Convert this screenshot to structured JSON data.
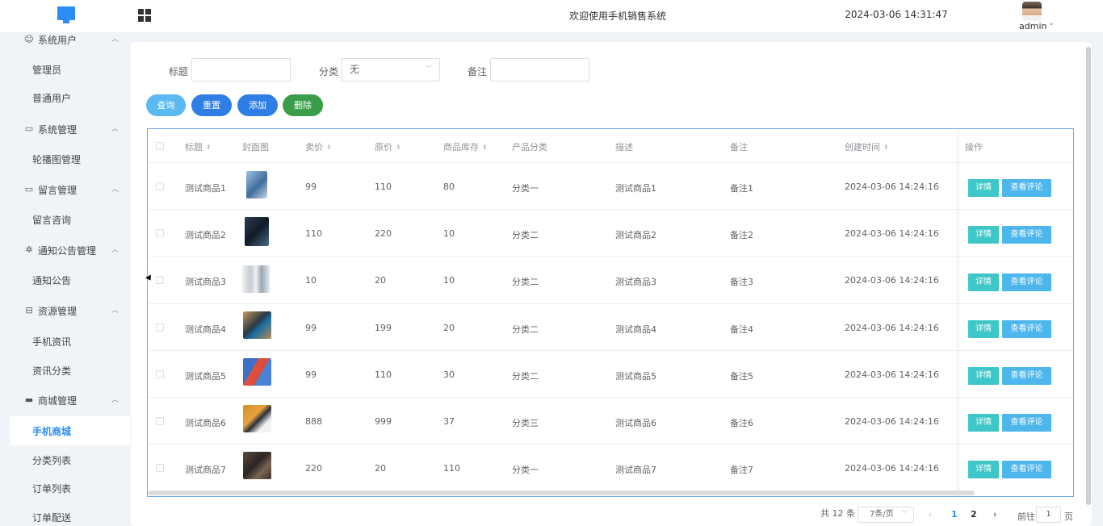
{
  "header": {
    "title": "欢迎使用手机销售系统",
    "datetime": "2024-03-06 14:31:47",
    "username": "admin",
    "user_caret": "˅"
  },
  "sidebar": {
    "groups": [
      {
        "label": "系统用户",
        "icon": "user-icon",
        "items": [
          "管理员",
          "普通用户"
        ]
      },
      {
        "label": "系统管理",
        "icon": "folder-icon",
        "items": [
          "轮播图管理"
        ]
      },
      {
        "label": "留言管理",
        "icon": "folder-icon",
        "items": [
          "留言咨询"
        ]
      },
      {
        "label": "通知公告管理",
        "icon": "loading-icon",
        "items": [
          "通知公告"
        ]
      },
      {
        "label": "资源管理",
        "icon": "database-icon",
        "items": [
          "手机资讯",
          "资讯分类"
        ]
      },
      {
        "label": "商城管理",
        "icon": "monitor-icon",
        "items": [
          "手机商城",
          "分类列表",
          "订单列表",
          "订单配送"
        ]
      }
    ],
    "active_item": "手机商城"
  },
  "filters": {
    "title_label": "标题",
    "title_value": "",
    "category_label": "分类",
    "category_value": "无",
    "remark_label": "备注",
    "remark_value": ""
  },
  "actions": {
    "query": "查询",
    "reset": "重置",
    "add": "添加",
    "delete": "删除"
  },
  "colors": {
    "query": "#5bb9ef",
    "reset": "#2f7ee6",
    "add": "#2f7ee6",
    "delete": "#3a9d4a",
    "primary": "#2d8cf0"
  },
  "table": {
    "columns": [
      "标题",
      "封面图",
      "卖价",
      "原价",
      "商品库存",
      "产品分类",
      "描述",
      "备注",
      "创建时间",
      "操作"
    ],
    "rows": [
      {
        "title": "测试商品1",
        "price": "99",
        "original": "110",
        "stock": "80",
        "category": "分类一",
        "desc": "测试商品1",
        "remark": "备注1",
        "created": "2024-03-06 14:24:16"
      },
      {
        "title": "测试商品2",
        "price": "110",
        "original": "220",
        "stock": "10",
        "category": "分类二",
        "desc": "测试商品2",
        "remark": "备注2",
        "created": "2024-03-06 14:24:16"
      },
      {
        "title": "测试商品3",
        "price": "10",
        "original": "20",
        "stock": "10",
        "category": "分类二",
        "desc": "测试商品3",
        "remark": "备注3",
        "created": "2024-03-06 14:24:16"
      },
      {
        "title": "测试商品4",
        "price": "99",
        "original": "199",
        "stock": "20",
        "category": "分类二",
        "desc": "测试商品4",
        "remark": "备注4",
        "created": "2024-03-06 14:24:16"
      },
      {
        "title": "测试商品5",
        "price": "99",
        "original": "110",
        "stock": "30",
        "category": "分类二",
        "desc": "测试商品5",
        "remark": "备注5",
        "created": "2024-03-06 14:24:16"
      },
      {
        "title": "测试商品6",
        "price": "888",
        "original": "999",
        "stock": "37",
        "category": "分类三",
        "desc": "测试商品6",
        "remark": "备注6",
        "created": "2024-03-06 14:24:16"
      },
      {
        "title": "测试商品7",
        "price": "220",
        "original": "20",
        "stock": "110",
        "category": "分类一",
        "desc": "测试商品7",
        "remark": "备注7",
        "created": "2024-03-06 14:24:16"
      }
    ],
    "detail_label": "详情",
    "review_label": "查看评论"
  },
  "pagination": {
    "total": "共 12 条",
    "page_size": "7条/页",
    "prev": "‹",
    "pages": [
      "1",
      "2"
    ],
    "next": "›",
    "jump_prefix": "前往",
    "jump_value": "1",
    "jump_suffix": "页"
  }
}
